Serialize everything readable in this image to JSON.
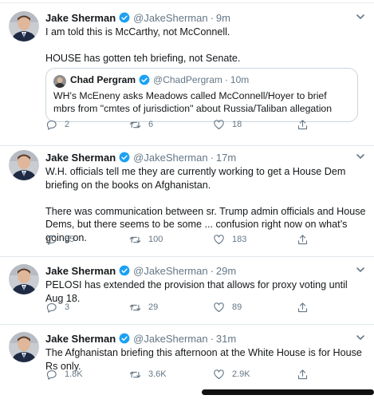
{
  "colors": {
    "verified": "#1da1f2",
    "muted": "#657786",
    "divider": "#e1e8ed"
  },
  "tweets": [
    {
      "name": "Jake Sherman",
      "handle": "@JakeSherman",
      "time": "9m",
      "text": "I am told this is McCarthy, not McConnell.\n\nHOUSE has gotten teh briefing, not Senate.",
      "quote": {
        "name": "Chad Pergram",
        "handle": "@ChadPergram",
        "time": "10m",
        "text": "WH's McEneny asks Meadows called McConnell/Hoyer to brief mbrs from \"cmtes of jurisdiction\" about Russia/Taliban allegation"
      },
      "replies": "2",
      "retweets": "6",
      "likes": "18"
    },
    {
      "name": "Jake Sherman",
      "handle": "@JakeSherman",
      "time": "17m",
      "text": "W.H. officials tell me they are currently working to get a House Dem briefing on the books on Afghanistan.\n\nThere was communication between sr. Trump admin officials and House Dems, but there seems to be some ... confusion right now on what’s going on.",
      "replies": "55",
      "retweets": "100",
      "likes": "183"
    },
    {
      "name": "Jake Sherman",
      "handle": "@JakeSherman",
      "time": "29m",
      "text": "PELOSI has extended the provision that allows for proxy voting until Aug 18.",
      "replies": "3",
      "retweets": "29",
      "likes": "89"
    },
    {
      "name": "Jake Sherman",
      "handle": "@JakeSherman",
      "time": "31m",
      "text": "The Afghanistan briefing this afternoon at the White House is for House Rs only.",
      "replies": "1.8K",
      "retweets": "3.6K",
      "likes": "2.9K"
    }
  ]
}
